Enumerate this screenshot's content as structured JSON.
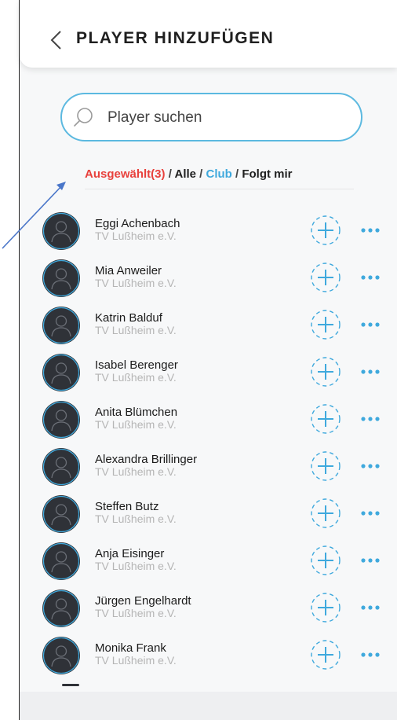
{
  "header": {
    "title": "PLAYER HINZUFÜGEN",
    "back_icon": "chevron-left-icon"
  },
  "search": {
    "placeholder": "Player suchen",
    "value": "",
    "icon": "search-icon"
  },
  "filters": {
    "selected_label": "Ausgewählt(3)",
    "all_label": "Alle",
    "club_label": "Club",
    "following_label": "Folgt mir",
    "separator": "/",
    "selected_color": "#e8413c",
    "club_color": "#3fa9dd"
  },
  "accent_color": "#3fa9dd",
  "players": [
    {
      "name": "Eggi Achenbach",
      "club": "TV Lußheim e.V."
    },
    {
      "name": "Mia Anweiler",
      "club": "TV Lußheim e.V."
    },
    {
      "name": "Katrin Balduf",
      "club": "TV Lußheim e.V."
    },
    {
      "name": "Isabel Berenger",
      "club": "TV Lußheim e.V."
    },
    {
      "name": "Anita Blümchen",
      "club": "TV Lußheim e.V."
    },
    {
      "name": "Alexandra Brillinger",
      "club": "TV Lußheim e.V."
    },
    {
      "name": "Steffen Butz",
      "club": "TV Lußheim e.V."
    },
    {
      "name": "Anja Eisinger",
      "club": "TV Lußheim e.V."
    },
    {
      "name": "Jürgen Engelhardt",
      "club": "TV Lußheim e.V."
    },
    {
      "name": "Monika Frank",
      "club": "TV Lußheim e.V."
    }
  ]
}
